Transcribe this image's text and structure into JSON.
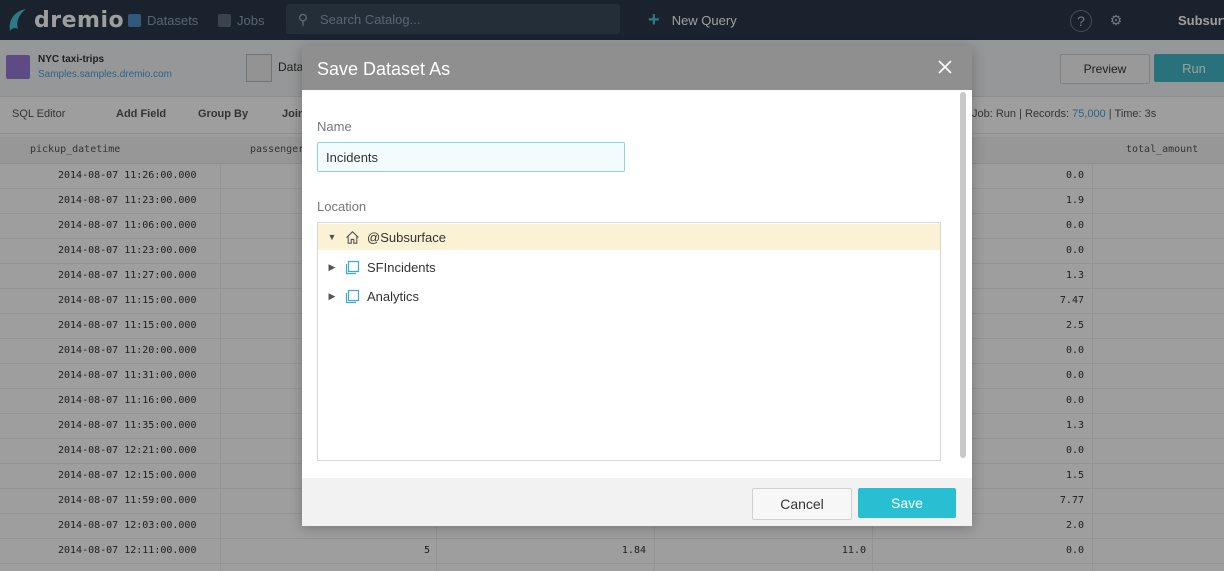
{
  "topbar": {
    "logo_text": "dremio",
    "nav": [
      {
        "label": "Datasets",
        "icon": "grid-icon"
      },
      {
        "label": "Jobs",
        "icon": "list-icon"
      }
    ],
    "search_placeholder": "Search Catalog...",
    "new_query_label": "New Query",
    "user_label": "Subsurf"
  },
  "subheader": {
    "dataset_title": "NYC taxi-trips",
    "dataset_path": "Samples.samples.dremio.com",
    "dataset_tab": "Data",
    "preview_label": "Preview",
    "run_label": "Run"
  },
  "toolbar": {
    "sql_editor": "SQL Editor",
    "add_field": "Add Field",
    "group_by": "Group By",
    "join": "Join",
    "job_prefix": "Job: Run | Records:",
    "records": "75,000",
    "time_suffix": "| Time: 3s"
  },
  "grid": {
    "columns": [
      "pickup_datetime",
      "passenger",
      "total_amount"
    ],
    "rows": [
      [
        "2014-08-07 11:26:00.000",
        "",
        "",
        "",
        "0.0"
      ],
      [
        "2014-08-07 11:23:00.000",
        "",
        "",
        "",
        "1.9"
      ],
      [
        "2014-08-07 11:06:00.000",
        "",
        "",
        "",
        "0.0"
      ],
      [
        "2014-08-07 11:23:00.000",
        "",
        "",
        "",
        "0.0"
      ],
      [
        "2014-08-07 11:27:00.000",
        "",
        "",
        "",
        "1.3"
      ],
      [
        "2014-08-07 11:15:00.000",
        "",
        "",
        "",
        "7.47"
      ],
      [
        "2014-08-07 11:15:00.000",
        "",
        "",
        "",
        "2.5"
      ],
      [
        "2014-08-07 11:20:00.000",
        "",
        "",
        "",
        "0.0"
      ],
      [
        "2014-08-07 11:31:00.000",
        "",
        "",
        "",
        "0.0"
      ],
      [
        "2014-08-07 11:16:00.000",
        "",
        "",
        "",
        "0.0"
      ],
      [
        "2014-08-07 11:35:00.000",
        "",
        "",
        "",
        "1.3"
      ],
      [
        "2014-08-07 12:21:00.000",
        "",
        "",
        "",
        "0.0"
      ],
      [
        "2014-08-07 12:15:00.000",
        "",
        "",
        "",
        "1.5"
      ],
      [
        "2014-08-07 11:59:00.000",
        "",
        "",
        "",
        "7.77"
      ],
      [
        "2014-08-07 12:03:00.000",
        "",
        "",
        "",
        "2.0"
      ],
      [
        "2014-08-07 12:11:00.000",
        "5",
        "1.84",
        "11.0",
        "0.0"
      ]
    ]
  },
  "modal": {
    "title": "Save Dataset As",
    "name_label": "Name",
    "name_value": "Incidents",
    "location_label": "Location",
    "tree": [
      {
        "label": "@Subsurface",
        "icon": "home-icon",
        "expanded": true,
        "selected": true
      },
      {
        "label": "SFIncidents",
        "icon": "space-icon",
        "expanded": false,
        "selected": false
      },
      {
        "label": "Analytics",
        "icon": "space-icon",
        "expanded": false,
        "selected": false
      }
    ],
    "cancel_label": "Cancel",
    "save_label": "Save"
  },
  "colors": {
    "topbar": "#2a394a",
    "accent": "#28bfd3",
    "selected_row": "#fbf2d6",
    "modal_header": "#8f8f8f"
  }
}
